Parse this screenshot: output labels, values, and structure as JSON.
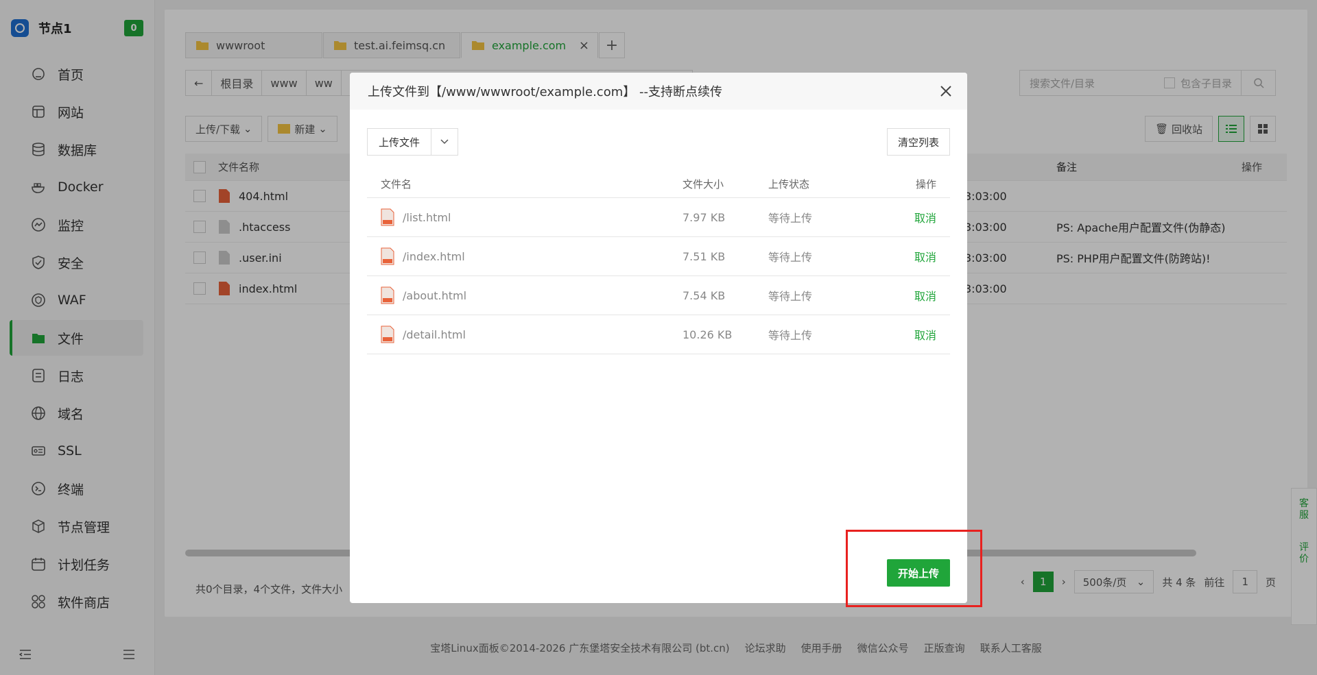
{
  "sidebar": {
    "title": "节点1",
    "badge": "0",
    "items": [
      {
        "label": "首页",
        "icon": "home-icon"
      },
      {
        "label": "网站",
        "icon": "website-icon"
      },
      {
        "label": "数据库",
        "icon": "database-icon"
      },
      {
        "label": "Docker",
        "icon": "docker-icon"
      },
      {
        "label": "监控",
        "icon": "monitor-icon"
      },
      {
        "label": "安全",
        "icon": "shield-icon"
      },
      {
        "label": "WAF",
        "icon": "waf-icon"
      },
      {
        "label": "文件",
        "icon": "folder-icon"
      },
      {
        "label": "日志",
        "icon": "log-icon"
      },
      {
        "label": "域名",
        "icon": "globe-icon"
      },
      {
        "label": "SSL",
        "icon": "ssl-icon"
      },
      {
        "label": "终端",
        "icon": "terminal-icon"
      },
      {
        "label": "节点管理",
        "icon": "cube-icon"
      },
      {
        "label": "计划任务",
        "icon": "calendar-icon"
      },
      {
        "label": "软件商店",
        "icon": "apps-icon"
      }
    ]
  },
  "tabs": [
    "wwwroot",
    "test.ai.feimsq.cn",
    "example.com"
  ],
  "path": {
    "back": "←",
    "root": "根目录",
    "seg1": "www",
    "seg2": "ww"
  },
  "search": {
    "placeholder": "搜索文件/目录",
    "include_sub": "包含子目录"
  },
  "toolbar": {
    "upload_download": "上传/下载",
    "new": "新建",
    "recycle": "回收站"
  },
  "file_table": {
    "col_name": "文件名称",
    "col_note": "备注",
    "col_op": "操作",
    "rows": [
      {
        "name": "404.html",
        "time": "3:03:00",
        "note": ""
      },
      {
        "name": ".htaccess",
        "time": "3:03:00",
        "note": "PS: Apache用户配置文件(伪静态)"
      },
      {
        "name": ".user.ini",
        "time": "3:03:00",
        "note": "PS: PHP用户配置文件(防跨站)!"
      },
      {
        "name": "index.html",
        "time": "3:03:00",
        "note": ""
      }
    ]
  },
  "summary": "共0个目录，4个文件，文件大小",
  "pager": {
    "page": "1",
    "per_page": "500条/页",
    "total": "共 4 条",
    "goto": "前往",
    "goto_value": "1",
    "unit": "页"
  },
  "footer": [
    "宝塔Linux面板©2014-2026 广东堡塔安全技术有限公司 (bt.cn)",
    "论坛求助",
    "使用手册",
    "微信公众号",
    "正版查询",
    "联系人工客服"
  ],
  "side_float": [
    "客服",
    "评价"
  ],
  "modal": {
    "title": "上传文件到【/www/wwwroot/example.com】 --支持断点续传",
    "upload_btn": "上传文件",
    "clear_btn": "清空列表",
    "headers": {
      "name": "文件名",
      "size": "文件大小",
      "state": "上传状态",
      "op": "操作"
    },
    "files": [
      {
        "name": "/list.html",
        "size": "7.97 KB",
        "state": "等待上传",
        "op": "取消"
      },
      {
        "name": "/index.html",
        "size": "7.51 KB",
        "state": "等待上传",
        "op": "取消"
      },
      {
        "name": "/about.html",
        "size": "7.54 KB",
        "state": "等待上传",
        "op": "取消"
      },
      {
        "name": "/detail.html",
        "size": "10.26 KB",
        "state": "等待上传",
        "op": "取消"
      }
    ],
    "start_btn": "开始上传"
  },
  "colors": {
    "accent": "#20a53a",
    "highlight": "#e8211f"
  }
}
